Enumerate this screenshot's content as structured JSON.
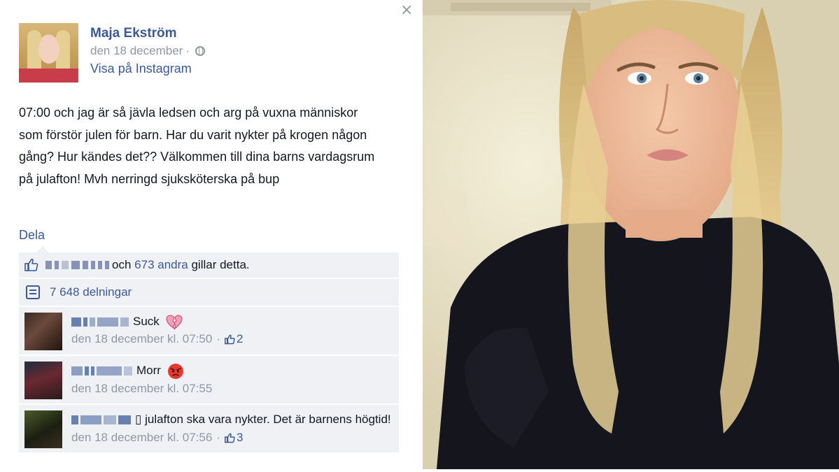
{
  "close_label": "×",
  "post": {
    "author": "Maja Ekström",
    "date": "den 18 december",
    "date_separator": "·",
    "source_link": "Visa på Instagram",
    "text": "07:00 och jag är så jävla ledsen och arg på vuxna människor som förstör julen för barn. Har du varit nykter på krogen någon gång? Hur kändes det?? Välkommen till dina barns vardagsrum på julafton! Mvh nerringd sjuksköterska på bup",
    "share_label": "Dela"
  },
  "likes": {
    "connector": "och",
    "others_link": "673 andra",
    "suffix": "gillar detta."
  },
  "shares": {
    "label": "7 648 delningar"
  },
  "comments": [
    {
      "text": "Suck",
      "emoji": "broken-heart-icon",
      "timestamp": "den 18 december kl. 07:50",
      "separator": "·",
      "likes": "2"
    },
    {
      "text": "Morr",
      "emoji": "angry-face-icon",
      "timestamp": "den 18 december kl. 07:55",
      "separator": "",
      "likes": ""
    },
    {
      "text": "julafton ska vara nykter. Det är barnens högtid!",
      "prefix_glyph": "▯",
      "timestamp": "den 18 december kl. 07:56",
      "separator": "·",
      "likes": "3"
    }
  ],
  "colors": {
    "link_blue": "#3b5998",
    "meta_gray": "#9197a3",
    "ufi_background": "#f0f1f5"
  }
}
